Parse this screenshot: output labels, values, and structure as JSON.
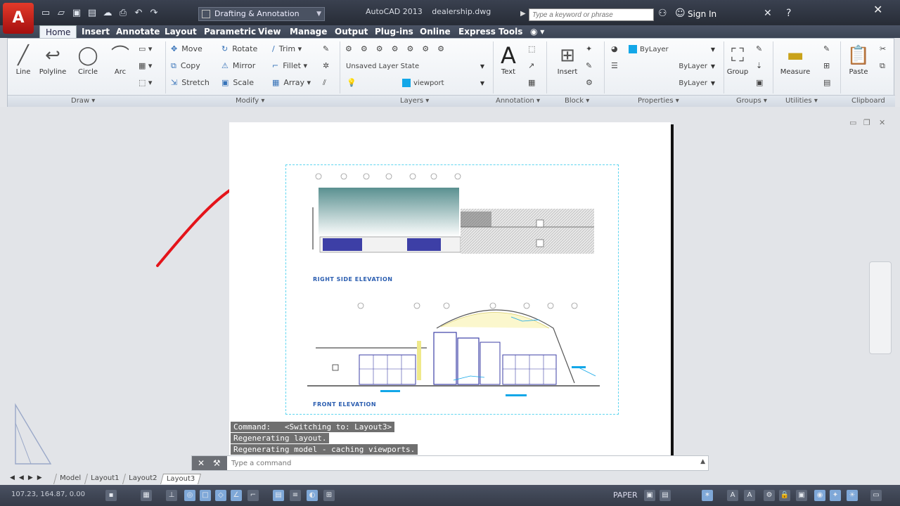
{
  "titlebar": {
    "app_logo": "A",
    "workspace": "Drafting & Annotation",
    "app_name": "AutoCAD 2013",
    "file_name": "dealership.dwg",
    "search_placeholder": "Type a keyword or phrase",
    "sign_in": "Sign In"
  },
  "ribbon_tabs": [
    "Home",
    "Insert",
    "Annotate",
    "Layout",
    "Parametric",
    "View",
    "Manage",
    "Output",
    "Plug-ins",
    "Online",
    "Express Tools"
  ],
  "ribbon": {
    "draw_tools": [
      "Line",
      "Polyline",
      "Circle",
      "Arc"
    ],
    "modify_tools": [
      "Move",
      "Rotate",
      "Trim",
      "Copy",
      "Mirror",
      "Fillet",
      "Stretch",
      "Scale",
      "Array"
    ],
    "layer_state": "Unsaved Layer State",
    "current_layer": "viewport",
    "annotation_tools": [
      "Text"
    ],
    "block_tools": [
      "Insert"
    ],
    "property_values": [
      "ByLayer",
      "ByLayer",
      "ByLayer"
    ],
    "group_tools": [
      "Group"
    ],
    "utility_tools": [
      "Measure"
    ],
    "clipboard_tools": [
      "Paste"
    ],
    "panel_labels": [
      "Draw",
      "Modify",
      "Layers",
      "Annotation",
      "Block",
      "Properties",
      "Groups",
      "Utilities",
      "Clipboard"
    ]
  },
  "drawing": {
    "label_right": "RIGHT SIDE ELEVATION",
    "label_front": "FRONT ELEVATION"
  },
  "command": {
    "history": [
      "Command:   <Switching to: Layout3>",
      "Regenerating layout.",
      "Regenerating model - caching viewports."
    ],
    "placeholder": "Type a command"
  },
  "layout_tabs": [
    "Model",
    "Layout1",
    "Layout2",
    "Layout3"
  ],
  "active_layout_tab": "Layout3",
  "statusbar": {
    "coords": "107.23, 164.87, 0.00",
    "space": "PAPER"
  },
  "colors": {
    "accent": "#13a7e8",
    "app_red": "#d0261a",
    "annotation_blue": "#2a5db0",
    "viewport_border": "#5ed5f0"
  }
}
